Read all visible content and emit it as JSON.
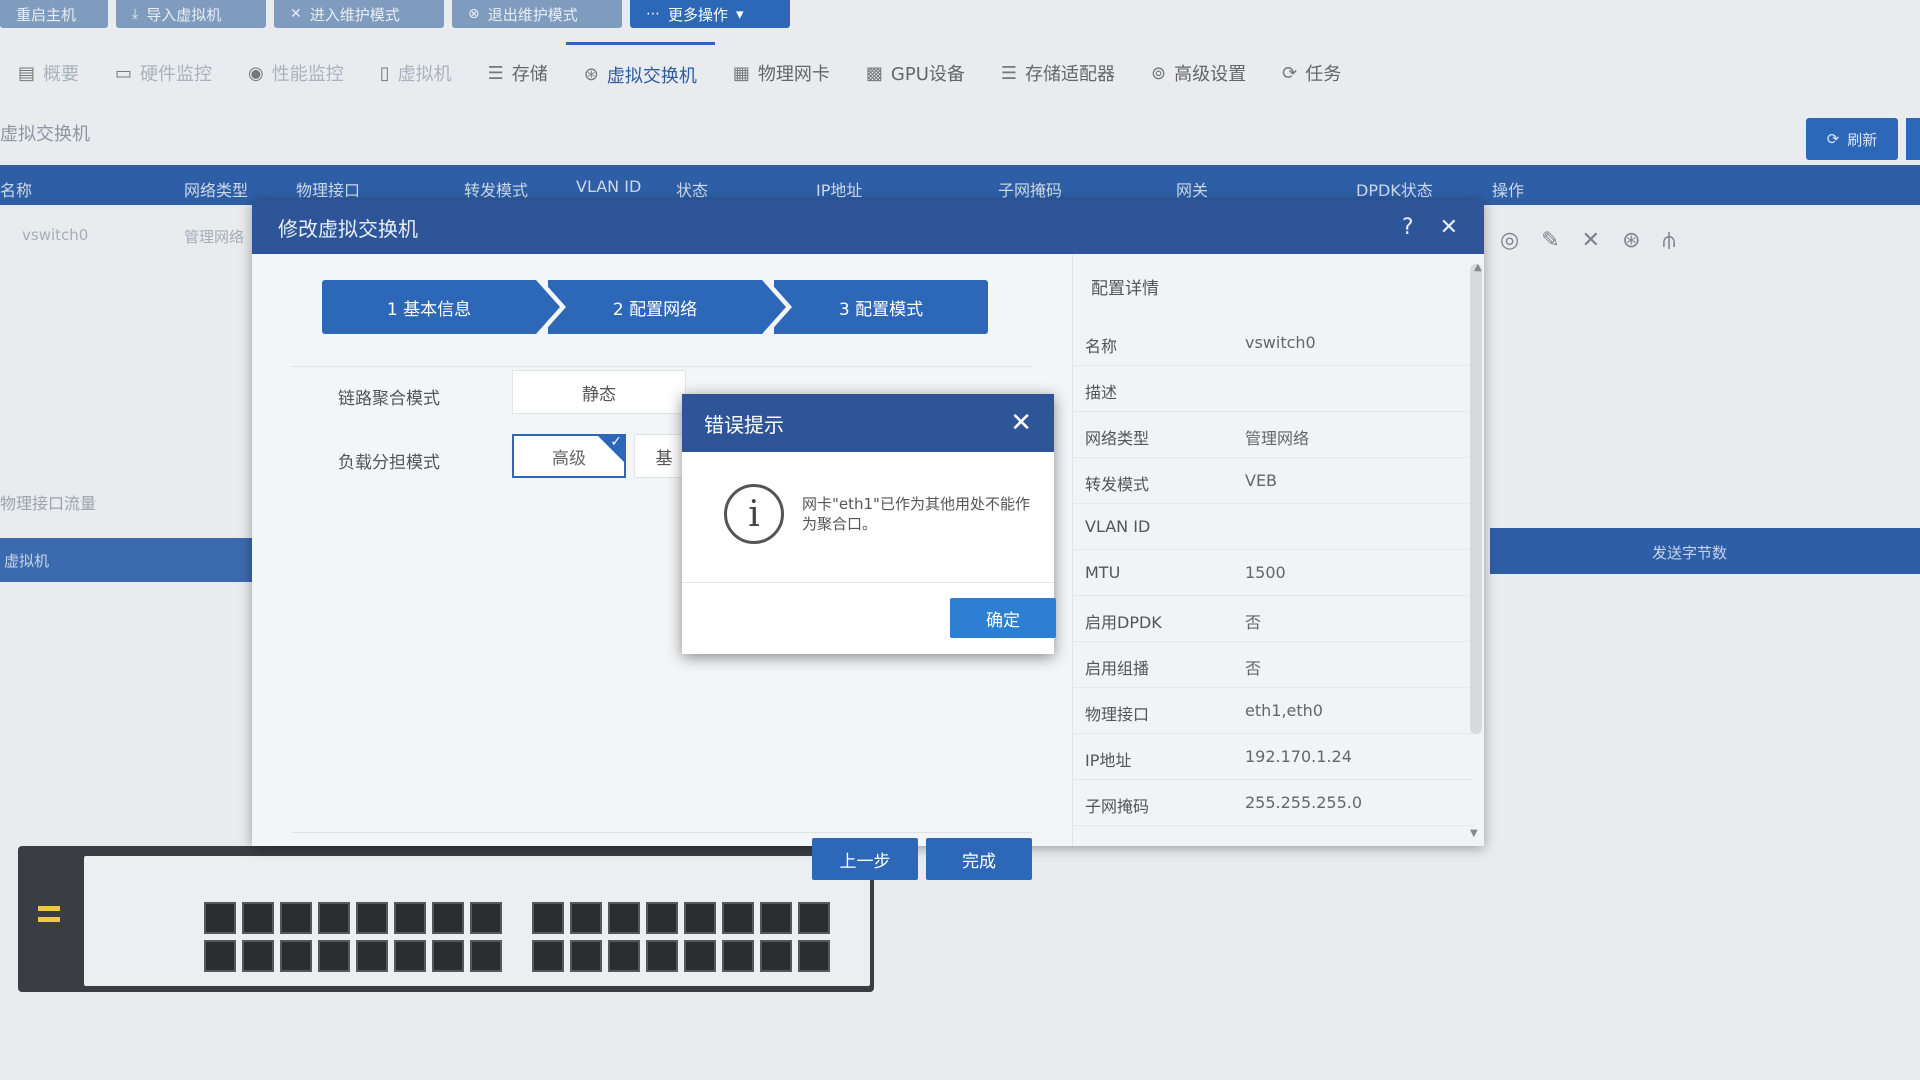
{
  "toolbar": {
    "buttons": [
      "重启主机",
      "导入虚拟机",
      "进入维护模式",
      "退出维护模式",
      "更多操作"
    ]
  },
  "nav": {
    "tabs": [
      {
        "label": "概要",
        "icon": "overview-icon"
      },
      {
        "label": "硬件监控",
        "icon": "monitor-icon"
      },
      {
        "label": "性能监控",
        "icon": "pin-icon"
      },
      {
        "label": "虚拟机",
        "icon": "vm-icon"
      },
      {
        "label": "存储",
        "icon": "storage-icon"
      },
      {
        "label": "虚拟交换机",
        "icon": "vswitch-icon"
      },
      {
        "label": "物理网卡",
        "icon": "nic-icon"
      },
      {
        "label": "GPU设备",
        "icon": "gpu-icon"
      },
      {
        "label": "存储适配器",
        "icon": "adapter-icon"
      },
      {
        "label": "高级设置",
        "icon": "settings-icon"
      },
      {
        "label": "任务",
        "icon": "task-icon"
      }
    ]
  },
  "section": {
    "title": "虚拟交换机",
    "refresh_label": "刷新"
  },
  "table": {
    "headers": [
      "名称",
      "网络类型",
      "物理接口",
      "转发模式",
      "VLAN ID",
      "状态",
      "IP地址",
      "子网掩码",
      "网关",
      "DPDK状态",
      "操作"
    ],
    "row": [
      "vswitch0",
      "管理网络"
    ]
  },
  "background": {
    "left_note": "物理接口流量",
    "left_bar": "虚拟机",
    "right_bar": "发送字节数"
  },
  "wizard": {
    "title": "修改虚拟交换机",
    "steps": [
      "1 基本信息",
      "2 配置网络",
      "3 配置模式"
    ],
    "aggregation_label": "链路聚合模式",
    "aggregation_value": "静态",
    "loadbalance_label": "负载分担模式",
    "loadbalance_value": "高级",
    "loadbalance_alt": "基",
    "prev_label": "上一步",
    "finish_label": "完成",
    "detail_title": "配置详情",
    "details": [
      {
        "k": "名称",
        "v": "vswitch0"
      },
      {
        "k": "描述",
        "v": ""
      },
      {
        "k": "网络类型",
        "v": "管理网络"
      },
      {
        "k": "转发模式",
        "v": "VEB"
      },
      {
        "k": "VLAN ID",
        "v": ""
      },
      {
        "k": "MTU",
        "v": "1500"
      },
      {
        "k": "启用DPDK",
        "v": "否"
      },
      {
        "k": "启用组播",
        "v": "否"
      },
      {
        "k": "物理接口",
        "v": "eth1,eth0"
      },
      {
        "k": "IP地址",
        "v": "192.170.1.24"
      },
      {
        "k": "子网掩码",
        "v": "255.255.255.0"
      }
    ]
  },
  "error_modal": {
    "title": "错误提示",
    "message": "网卡\"eth1\"已作为其他用处不能作为聚合口。",
    "ok_label": "确定"
  },
  "colors": {
    "accent": "#2d68b8",
    "header": "#2d5598"
  }
}
